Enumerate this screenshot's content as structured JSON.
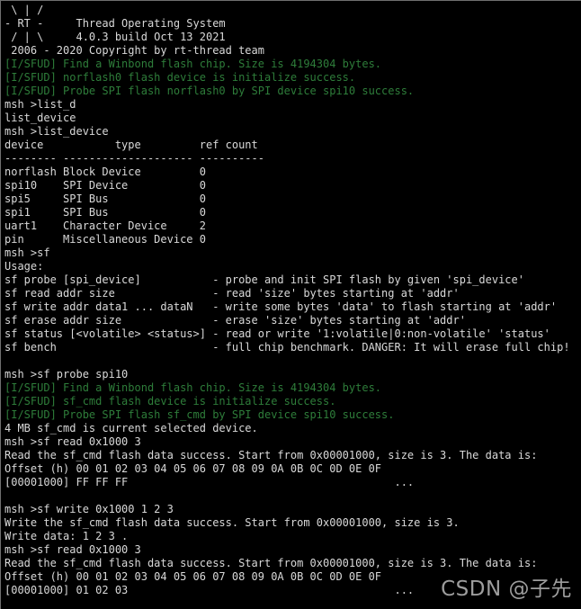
{
  "terminal": {
    "title": "RT-Thread MSH Terminal",
    "background_color": "#000000",
    "foreground_color": "#d9d9d9",
    "log_color": "#2e7d3a",
    "watermark_color": "#b9b9b9"
  },
  "watermark": {
    "text": "CSDN @子先"
  },
  "banner": {
    "line1": " \\ | /",
    "line2": "- RT -     Thread Operating System",
    "line3": " / | \\     4.0.3 build Oct 13 2021",
    "line4": " 2006 - 2020 Copyright by rt-thread team"
  },
  "lines": [
    {
      "text": " \\ | /",
      "type": "normal"
    },
    {
      "text": "- RT -     Thread Operating System",
      "type": "normal"
    },
    {
      "text": " / | \\     4.0.3 build Oct 13 2021",
      "type": "normal"
    },
    {
      "text": " 2006 - 2020 Copyright by rt-thread team",
      "type": "normal"
    },
    {
      "text": "[I/SFUD] Find a Winbond flash chip. Size is 4194304 bytes.",
      "type": "sfud"
    },
    {
      "text": "[I/SFUD] norflash0 flash device is initialize success.",
      "type": "sfud"
    },
    {
      "text": "[I/SFUD] Probe SPI flash norflash0 by SPI device spi10 success.",
      "type": "sfud"
    },
    {
      "text": "msh >list_d",
      "type": "normal"
    },
    {
      "text": "list_device",
      "type": "normal"
    },
    {
      "text": "msh >list_device",
      "type": "normal"
    },
    {
      "text": "device           type         ref count",
      "type": "normal"
    },
    {
      "text": "-------- -------------------- ----------",
      "type": "normal"
    },
    {
      "text": "norflash Block Device         0",
      "type": "normal"
    },
    {
      "text": "spi10    SPI Device           0",
      "type": "normal"
    },
    {
      "text": "spi5     SPI Bus              0",
      "type": "normal"
    },
    {
      "text": "spi1     SPI Bus              0",
      "type": "normal"
    },
    {
      "text": "uart1    Character Device     2",
      "type": "normal"
    },
    {
      "text": "pin      Miscellaneous Device 0",
      "type": "normal"
    },
    {
      "text": "msh >sf",
      "type": "normal"
    },
    {
      "text": "Usage:",
      "type": "normal"
    },
    {
      "text": "sf probe [spi_device]           - probe and init SPI flash by given 'spi_device'",
      "type": "normal"
    },
    {
      "text": "sf read addr size               - read 'size' bytes starting at 'addr'",
      "type": "normal"
    },
    {
      "text": "sf write addr data1 ... dataN   - write some bytes 'data' to flash starting at 'addr'",
      "type": "normal"
    },
    {
      "text": "sf erase addr size              - erase 'size' bytes starting at 'addr'",
      "type": "normal"
    },
    {
      "text": "sf status [<volatile> <status>] - read or write '1:volatile|0:non-volatile' 'status'",
      "type": "normal"
    },
    {
      "text": "sf bench                        - full chip benchmark. DANGER: It will erase full chip!",
      "type": "normal"
    },
    {
      "text": "",
      "type": "blank"
    },
    {
      "text": "msh >sf probe spi10",
      "type": "normal"
    },
    {
      "text": "[I/SFUD] Find a Winbond flash chip. Size is 4194304 bytes.",
      "type": "sfud"
    },
    {
      "text": "[I/SFUD] sf_cmd flash device is initialize success.",
      "type": "sfud"
    },
    {
      "text": "[I/SFUD] Probe SPI flash sf_cmd by SPI device spi10 success.",
      "type": "sfud"
    },
    {
      "text": "4 MB sf_cmd is current selected device.",
      "type": "normal"
    },
    {
      "text": "msh >sf read 0x1000 3",
      "type": "normal"
    },
    {
      "text": "Read the sf_cmd flash data success. Start from 0x00001000, size is 3. The data is:",
      "type": "normal"
    },
    {
      "text": "Offset (h) 00 01 02 03 04 05 06 07 08 09 0A 0B 0C 0D 0E 0F",
      "type": "normal"
    },
    {
      "text": "[00001000] FF FF FF                                         ...",
      "type": "normal"
    },
    {
      "text": "",
      "type": "blank"
    },
    {
      "text": "msh >sf write 0x1000 1 2 3",
      "type": "normal"
    },
    {
      "text": "Write the sf_cmd flash data success. Start from 0x00001000, size is 3.",
      "type": "normal"
    },
    {
      "text": "Write data: 1 2 3 .",
      "type": "normal"
    },
    {
      "text": "msh >sf read 0x1000 3",
      "type": "normal"
    },
    {
      "text": "Read the sf_cmd flash data success. Start from 0x00001000, size is 3. The data is:",
      "type": "normal"
    },
    {
      "text": "Offset (h) 00 01 02 03 04 05 06 07 08 09 0A 0B 0C 0D 0E 0F",
      "type": "normal"
    },
    {
      "text": "[00001000] 01 02 03                                         ...",
      "type": "normal"
    }
  ],
  "device_table": {
    "headers": [
      "device",
      "type",
      "ref count"
    ],
    "rows": [
      {
        "device": "norflash",
        "type": "Block Device",
        "ref_count": "0"
      },
      {
        "device": "spi10",
        "type": "SPI Device",
        "ref_count": "0"
      },
      {
        "device": "spi5",
        "type": "SPI Bus",
        "ref_count": "0"
      },
      {
        "device": "spi1",
        "type": "SPI Bus",
        "ref_count": "0"
      },
      {
        "device": "uart1",
        "type": "Character Device",
        "ref_count": "2"
      },
      {
        "device": "pin",
        "type": "Miscellaneous Device",
        "ref_count": "0"
      }
    ]
  },
  "sf_usage": {
    "header": "Usage:",
    "entries": [
      {
        "command": "sf probe [spi_device]",
        "description": "probe and init SPI flash by given 'spi_device'"
      },
      {
        "command": "sf read addr size",
        "description": "read 'size' bytes starting at 'addr'"
      },
      {
        "command": "sf write addr data1 ... dataN",
        "description": "write some bytes 'data' to flash starting at 'addr'"
      },
      {
        "command": "sf erase addr size",
        "description": "erase 'size' bytes starting at 'addr'"
      },
      {
        "command": "sf status [<volatile> <status>]",
        "description": "read or write '1:volatile|0:non-volatile' 'status'"
      },
      {
        "command": "sf bench",
        "description": "full chip benchmark. DANGER: It will erase full chip!"
      }
    ]
  },
  "commands_entered": [
    "list_d",
    "list_device",
    "sf",
    "sf probe spi10",
    "sf read 0x1000 3",
    "sf write 0x1000 1 2 3",
    "sf read 0x1000 3"
  ],
  "prompt": "msh >"
}
